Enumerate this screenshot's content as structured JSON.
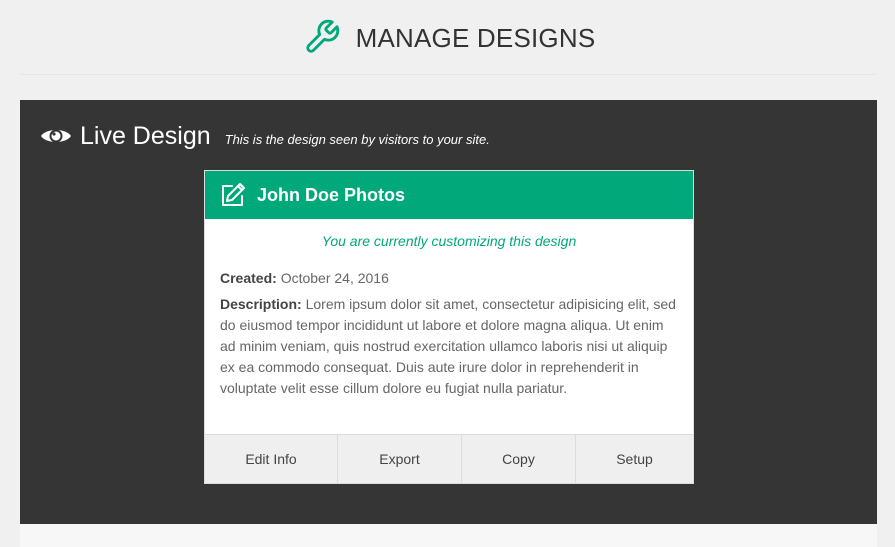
{
  "header": {
    "title": "MANAGE DESIGNS",
    "icon": "wrench-icon",
    "accent": "#00a87a"
  },
  "live": {
    "title": "Live Design",
    "subtitle": "This is the design seen by visitors to your site.",
    "icon": "eye-icon",
    "background": "#353535"
  },
  "card": {
    "name": "John Doe Photos",
    "icon": "pencil-square-icon",
    "status": "You are currently customizing this design",
    "created_label": "Created:",
    "created_value": "October 24, 2016",
    "description_label": "Description:",
    "description_value": "Lorem ipsum dolor sit amet, consectetur adipisicing elit, sed do eiusmod tempor incididunt ut labore et dolore magna aliqua. Ut enim ad minim veniam, quis nostrud exercitation ullamco laboris nisi ut aliquip ex ea commodo consequat. Duis aute irure dolor in reprehenderit in voluptate velit esse cillum dolore eu fugiat nulla pariatur.",
    "actions": [
      "Edit Info",
      "Export",
      "Copy",
      "Setup"
    ]
  }
}
